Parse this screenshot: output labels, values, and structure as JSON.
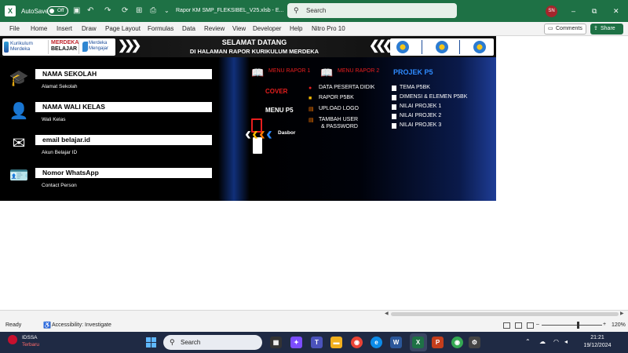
{
  "titlebar": {
    "autosave_label": "AutoSave",
    "autosave_state": "Off",
    "doc_title": "Rapor KM SMP_FLEKSIBEL_V25.xlsb - E...",
    "search_placeholder": "Search",
    "user_initials": "SN",
    "win_minimize": "–",
    "win_restore": "⧉",
    "win_close": "✕"
  },
  "ribbon": {
    "tabs": [
      "File",
      "Home",
      "Insert",
      "Draw",
      "Page Layout",
      "Formulas",
      "Data",
      "Review",
      "View",
      "Developer",
      "Help",
      "Nitro Pro 10"
    ],
    "comments_label": "Comments",
    "share_label": "Share"
  },
  "dashboard": {
    "logo_km_line1": "Kurikulum",
    "logo_km_line2": "Merdeka",
    "logo_mb_line1": "MERDEKA",
    "logo_mb_line2": "BELAJAR",
    "logo_mm_line1": "Merdeka",
    "logo_mm_line2": "Mengajar",
    "welcome_line1": "SELAMAT DATANG",
    "welcome_line2": "DI HALAMAN RAPOR KURIKULUM MERDEKA",
    "info": [
      {
        "title": "NAMA SEKOLAH",
        "sub": "Alamat Sekolah",
        "icon": "graduation-cap-icon"
      },
      {
        "title": "NAMA WALI KELAS",
        "sub": "Wali Kelas",
        "icon": "user-icon"
      },
      {
        "title": "email belajar.id",
        "sub": "Akun Belajar ID",
        "icon": "envelope-icon"
      },
      {
        "title": "Nomor WhatsApp",
        "sub": "Contact Person",
        "icon": "id-card-icon"
      }
    ],
    "menu_rapor_1": "MENU RAPOR 1",
    "menu_rapor_2": "MENU RAPOR 2",
    "cover": "COVER",
    "menu_p5": "MENU P5",
    "dasbor": "Dasbor",
    "menu2_items": [
      "DATA PESERTA DIDIK",
      "RAPOR P5BK",
      "UPLOAD LOGO",
      "TAMBAH USER",
      "& PASSWORD"
    ],
    "projek_title": "PROJEK P5",
    "projek_items": [
      "TEMA P5BK",
      "DIMENSI & ELEMEN P5BK",
      "NILAI PROJEK 1",
      "NILAI PROJEK 2",
      "NILAI PROJEK 3"
    ],
    "colors": {
      "red": "#e81e1e",
      "blue_accent": "#2e8bff",
      "excel_green": "#1e7145"
    }
  },
  "status": {
    "ready": "Ready",
    "accessibility": "Accessibility: Investigate",
    "zoom": "120%",
    "zoom_minus": "–",
    "zoom_plus": "+"
  },
  "taskbar": {
    "weather_line1": "IDSSA",
    "weather_line2": "Terbaru",
    "search_placeholder": "Search",
    "time": "21:21",
    "date": "19/12/2024"
  }
}
